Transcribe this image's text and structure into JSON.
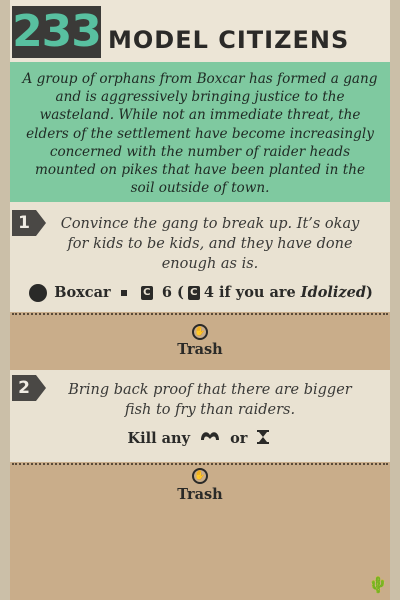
{
  "card": {
    "number": "233",
    "title": "MODEL CITIZENS",
    "intro": "A group of orphans from Boxcar has formed a gang and is aggressively bringing justice to the wasteland. While not an immediate threat, the elders of the settlement have become increasingly concerned with the number of raider heads mounted on pikes that have been planted in the soil outside of town."
  },
  "options": [
    {
      "badge": "1",
      "text": "Convince the gang to break up. It’s okay for kids to be kids, and they have done enough as is.",
      "requirement": {
        "location": "Boxcar",
        "check_value": "6",
        "alt_open": "(",
        "alt_value": "4 if you are ",
        "alt_condition": "Idolized",
        "alt_close": ")"
      },
      "result_label": "Trash"
    },
    {
      "badge": "2",
      "text": "Bring back proof that there are bigger fish to fry than raiders.",
      "requirement": {
        "prefix": "Kill any",
        "connector": "or"
      },
      "result_label": "Trash"
    }
  ],
  "icons": {
    "header_number_color": "#58c0a0",
    "intro_bg": "#7fc9a0",
    "result_bg": "#c9ad8a"
  }
}
